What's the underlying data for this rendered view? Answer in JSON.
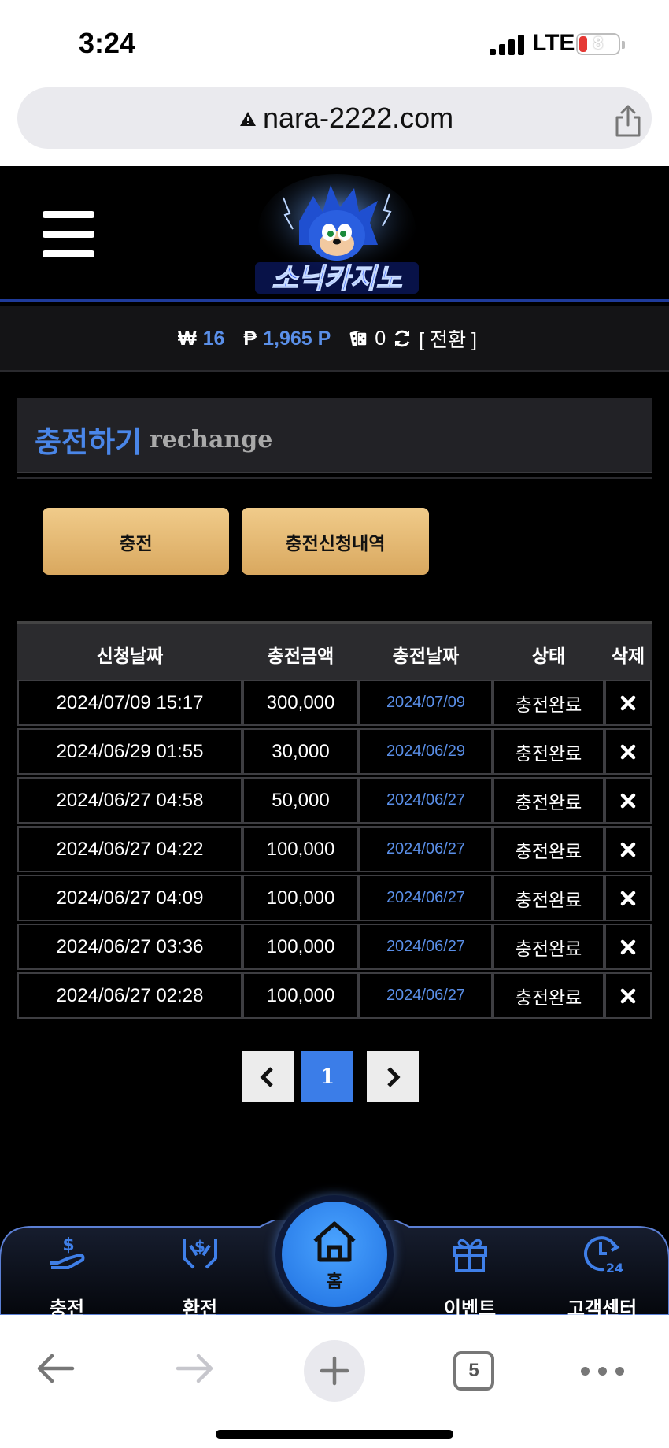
{
  "status_bar": {
    "time": "3:24",
    "network": "LTE",
    "battery": "8"
  },
  "browser": {
    "url": "nara-2222.com",
    "tab_count": "5"
  },
  "balance": {
    "won_symbol": "₩",
    "won_value": "16",
    "point_symbol": "₱",
    "point_value": "1,965 P",
    "chip_value": "0",
    "switch_label": "[ 전환 ]"
  },
  "page": {
    "title_ko": "충전하기",
    "title_en": "rechange"
  },
  "actions": {
    "charge_label": "충전",
    "history_label": "충전신청내역"
  },
  "table": {
    "headers": [
      "신청날짜",
      "충전금액",
      "충전날짜",
      "상태",
      "삭제"
    ],
    "rows": [
      {
        "request_date": "2024/07/09 15:17",
        "amount": "300,000",
        "charge_date": "2024/07/09",
        "status": "충전완료"
      },
      {
        "request_date": "2024/06/29 01:55",
        "amount": "30,000",
        "charge_date": "2024/06/29",
        "status": "충전완료"
      },
      {
        "request_date": "2024/06/27 04:58",
        "amount": "50,000",
        "charge_date": "2024/06/27",
        "status": "충전완료"
      },
      {
        "request_date": "2024/06/27 04:22",
        "amount": "100,000",
        "charge_date": "2024/06/27",
        "status": "충전완료"
      },
      {
        "request_date": "2024/06/27 04:09",
        "amount": "100,000",
        "charge_date": "2024/06/27",
        "status": "충전완료"
      },
      {
        "request_date": "2024/06/27 03:36",
        "amount": "100,000",
        "charge_date": "2024/06/27",
        "status": "충전완료"
      },
      {
        "request_date": "2024/06/27 02:28",
        "amount": "100,000",
        "charge_date": "2024/06/27",
        "status": "충전완료"
      }
    ]
  },
  "pagination": {
    "current": "1"
  },
  "bottom_nav": {
    "charge": "충전",
    "exchange": "환전",
    "home": "홈",
    "event": "이벤트",
    "support": "고객센터"
  },
  "colors": {
    "accent_blue": "#4a86e8",
    "gold": "#e6bb74",
    "header_line": "#1f3b9a"
  },
  "icons": [
    "warning-icon",
    "share-icon",
    "hamburger-icon",
    "dice-icon",
    "refresh-icon",
    "delete-x-icon",
    "chevron-left-icon",
    "chevron-right-icon",
    "charge-icon",
    "exchange-icon",
    "home-icon",
    "gift-icon",
    "support-24-icon",
    "back-arrow-icon",
    "forward-arrow-icon",
    "plus-icon",
    "more-icon"
  ]
}
